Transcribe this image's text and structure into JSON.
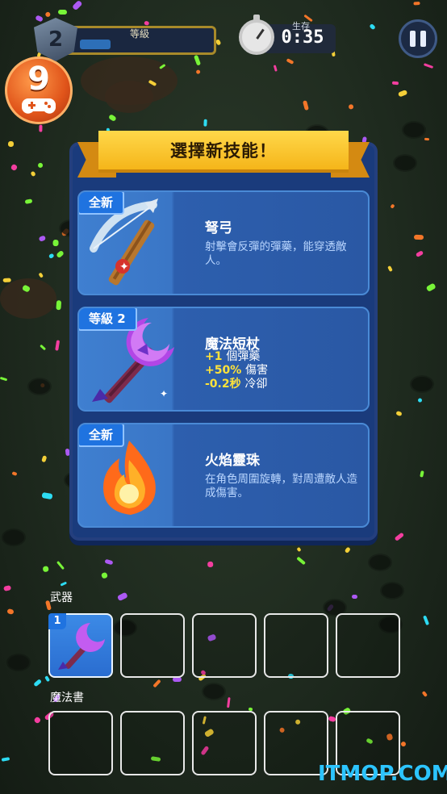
{
  "hud": {
    "level_label": "等級",
    "level_value": "2",
    "level_progress": 0.25,
    "combo_value": "9",
    "combo_icon": "gamepad-icon",
    "timer_label": "生存",
    "timer_value": "0:35",
    "pause_icon": "pause-icon"
  },
  "dialog": {
    "title": "選擇新技能！",
    "cards": [
      {
        "badge": "全新",
        "name": "弩弓",
        "desc": "射擊會反彈的彈藥，能穿透敵人。",
        "icon": "crossbow-icon"
      },
      {
        "badge": "等級 2",
        "name": "魔法短杖",
        "icon": "magic-wand-icon",
        "stats": [
          {
            "value": "+1",
            "text": "個彈藥"
          },
          {
            "value": "+50%",
            "text": "傷害"
          },
          {
            "value": "-0.2秒",
            "text": "冷卻"
          }
        ]
      },
      {
        "badge": "全新",
        "name": "火焰靈珠",
        "desc": "在角色周圍旋轉，對周遭敵人造成傷害。",
        "icon": "fire-orb-icon"
      }
    ]
  },
  "inventory": {
    "weapons_label": "武器",
    "weapons": [
      {
        "level": "1",
        "icon": "magic-wand-icon"
      },
      null,
      null,
      null,
      null
    ],
    "books_label": "魔法書",
    "books": [
      null,
      null,
      null,
      null,
      null
    ]
  },
  "watermark": "ITMOP.COM",
  "colors": {
    "banner": "#f5b51a",
    "panel": "#1a3b7c",
    "badge": "#1f73e0",
    "stat_highlight": "#ffe33a",
    "watermark": "#2cc4ff"
  }
}
